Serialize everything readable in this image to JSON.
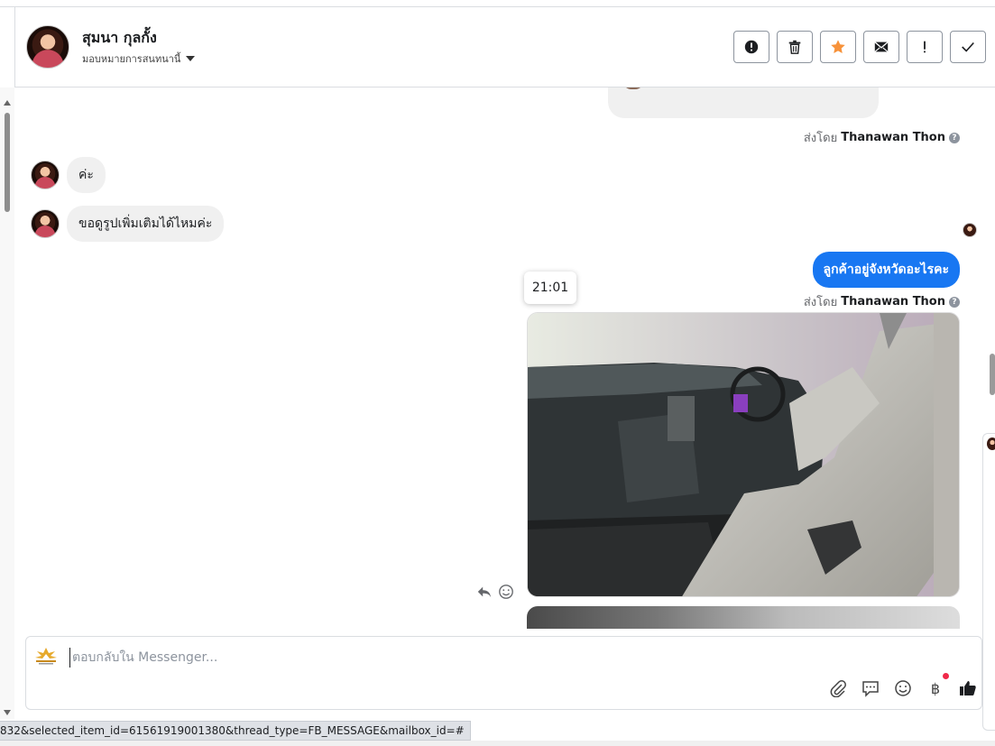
{
  "header": {
    "contact_name": "สุมนา กุลกั้ง",
    "assign_label": "มอบหมายการสนทนานี้",
    "toolbar": [
      "report-icon",
      "trash-icon",
      "star-icon",
      "mail-icon",
      "exclamation-icon",
      "check-icon"
    ],
    "colors": {
      "star": "#f7923a"
    }
  },
  "messages": {
    "sent_by_prefix": "ส่งโดย",
    "sender_name": "Thanawan Thon",
    "incoming_1": "ค่ะ",
    "incoming_2": "ขอดูรูปเพิ่มเติมได้ไหมค่ะ",
    "outgoing_1": "ลูกค้าอยู่จังหวัดอะไรคะ",
    "time_tooltip": "21:01",
    "outgoing_color": "#1877f2"
  },
  "composer": {
    "placeholder": "ตอบกลับใน Messenger...",
    "tools": [
      "paperclip-icon",
      "saved-reply-icon",
      "emoji-icon",
      "baht-icon",
      "thumbs-up-icon"
    ],
    "baht_symbol": "฿"
  },
  "status_bar": {
    "url": "832&selected_item_id=61561919001380&thread_type=FB_MESSAGE&mailbox_id=#"
  }
}
